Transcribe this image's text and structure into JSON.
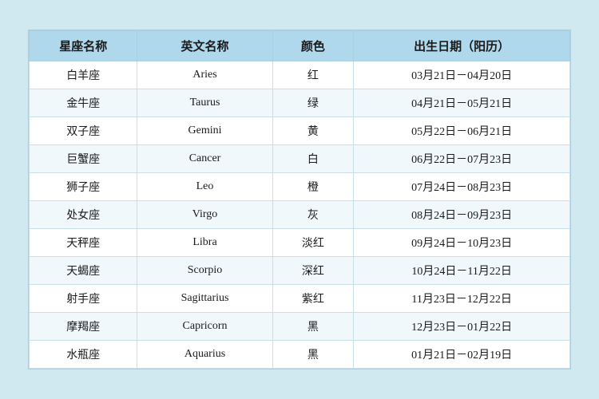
{
  "table": {
    "headers": {
      "col1": "星座名称",
      "col2": "英文名称",
      "col3": "颜色",
      "col4": "出生日期（阳历）"
    },
    "rows": [
      {
        "cn": "白羊座",
        "en": "Aries",
        "color": "红",
        "date": "03月21日－04月20日"
      },
      {
        "cn": "金牛座",
        "en": "Taurus",
        "color": "绿",
        "date": "04月21日－05月21日"
      },
      {
        "cn": "双子座",
        "en": "Gemini",
        "color": "黄",
        "date": "05月22日－06月21日"
      },
      {
        "cn": "巨蟹座",
        "en": "Cancer",
        "color": "白",
        "date": "06月22日－07月23日"
      },
      {
        "cn": "狮子座",
        "en": "Leo",
        "color": "橙",
        "date": "07月24日－08月23日"
      },
      {
        "cn": "处女座",
        "en": "Virgo",
        "color": "灰",
        "date": "08月24日－09月23日"
      },
      {
        "cn": "天秤座",
        "en": "Libra",
        "color": "淡红",
        "date": "09月24日－10月23日"
      },
      {
        "cn": "天蝎座",
        "en": "Scorpio",
        "color": "深红",
        "date": "10月24日－11月22日"
      },
      {
        "cn": "射手座",
        "en": "Sagittarius",
        "color": "紫红",
        "date": "11月23日－12月22日"
      },
      {
        "cn": "摩羯座",
        "en": "Capricorn",
        "color": "黑",
        "date": "12月23日－01月22日"
      },
      {
        "cn": "水瓶座",
        "en": "Aquarius",
        "color": "黑",
        "date": "01月21日－02月19日"
      }
    ]
  }
}
